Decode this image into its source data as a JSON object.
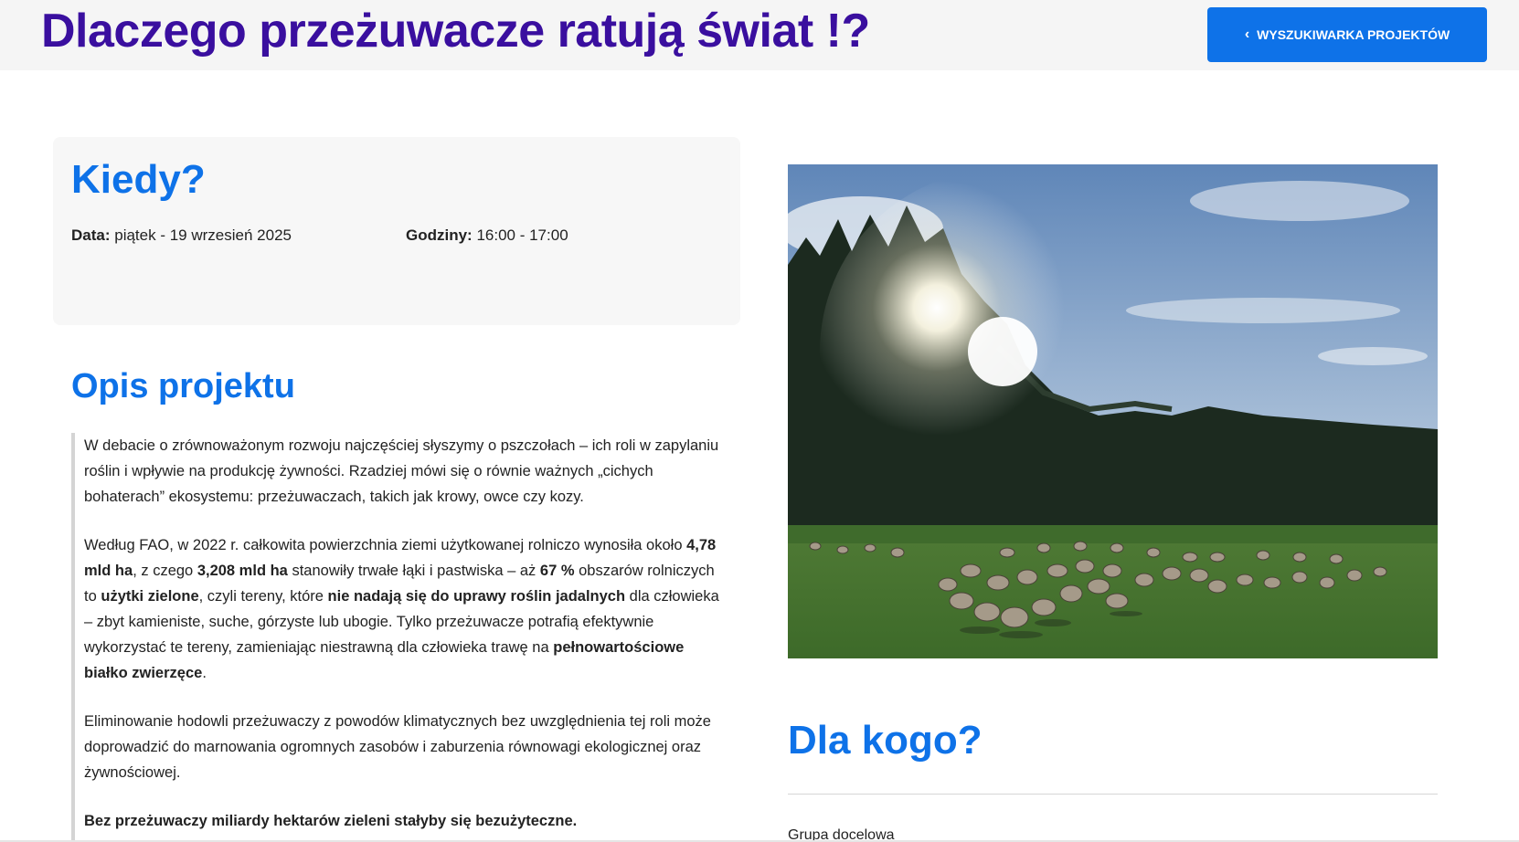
{
  "header": {
    "title": "Dlaczego przeżuwacze ratują świat !?",
    "search_button_label": "WYSZUKIWARKA PROJEKTÓW",
    "search_button_icon": "chevron-left-icon",
    "title_color": "#3a0f9f",
    "button_color": "#0e72e8"
  },
  "when": {
    "title": "Kiedy?",
    "date_label": "Data:",
    "date_value": "piątek - 19 wrzesień 2025",
    "hours_label": "Godziny:",
    "hours_value": "16:00 - 17:00"
  },
  "description": {
    "title": "Opis projektu",
    "p1": "W debacie o zrównoważonym rozwoju najczęściej słyszymy o pszczołach – ich roli w zapylaniu roślin i wpływie na produkcję żywności. Rzadziej mówi się o równie ważnych „cichych bohaterach” ekosystemu: przeżuwaczach, takich jak krowy, owce czy kozy.",
    "p2_a": "Według FAO, w 2022 r. całkowita powierzchnia ziemi użytkowanej rolniczo wynosiła około ",
    "p2_b": "4,78 mld ha",
    "p2_c": ", z czego ",
    "p2_d": "3,208 mld ha",
    "p2_e": " stanowiły trwałe łąki i pastwiska – aż ",
    "p2_f": "67 %",
    "p2_g": " obszarów rolniczych to ",
    "p2_h": "użytki zielone",
    "p2_i": ", czyli tereny, które ",
    "p2_j": "nie nadają się do uprawy roślin jadalnych",
    "p2_k": " dla człowieka – zbyt kamieniste, suche, górzyste lub ubogie. Tylko przeżuwacze potrafią efektywnie wykorzystać te tereny, zamieniając niestrawną dla człowieka trawę na ",
    "p2_l": "pełnowartościowe białko zwierzęce",
    "p2_m": ".",
    "p3": "Eliminowanie hodowli przeżuwaczy z powodów klimatycznych bez uwzględnienia tej roli może doprowadzić do marnowania ogromnych zasobów i zaburzenia równowagi ekologicznej oraz żywnościowej.",
    "p4": "Bez przeżuwaczy miliardy hektarów zieleni stałyby się bezużyteczne."
  },
  "target": {
    "title": "Dla kogo?",
    "group_label": "Grupa docelowa"
  }
}
